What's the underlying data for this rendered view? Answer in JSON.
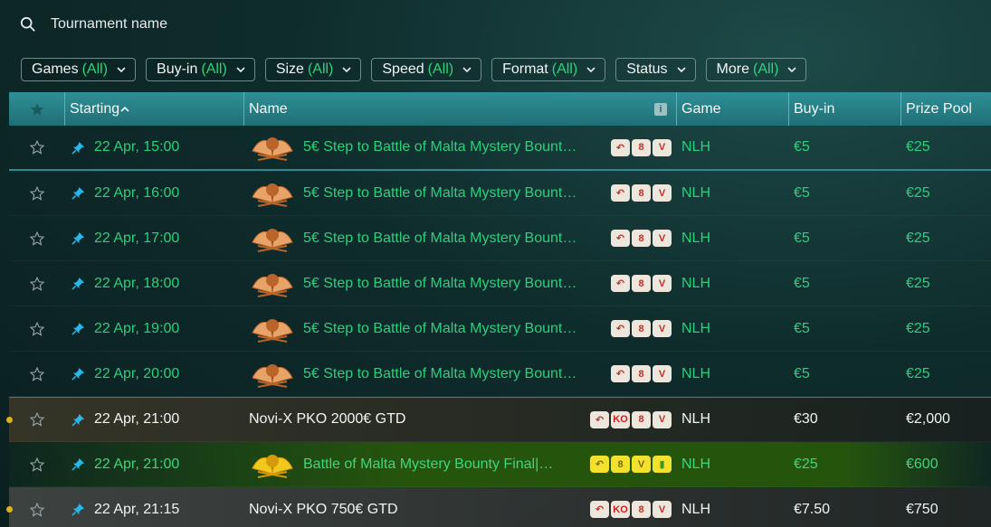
{
  "search": {
    "placeholder": "Tournament name"
  },
  "filters": [
    {
      "label": "Games",
      "value": "(All)"
    },
    {
      "label": "Buy-in",
      "value": "(All)"
    },
    {
      "label": "Size",
      "value": "(All)"
    },
    {
      "label": "Speed",
      "value": "(All)"
    },
    {
      "label": "Format",
      "value": "(All)"
    },
    {
      "label": "Status",
      "value": ""
    },
    {
      "label": "More",
      "value": "(All)"
    }
  ],
  "columns": {
    "starting": "Starting",
    "name": "Name",
    "game": "Game",
    "buyin": "Buy-in",
    "prize": "Prize Pool"
  },
  "rows": [
    {
      "start": "22 Apr, 15:00",
      "name": "5€ Step to Battle of Malta Mystery Bount…",
      "game": "NLH",
      "buyin": "€5",
      "prize": "€25"
    },
    {
      "start": "22 Apr, 16:00",
      "name": "5€ Step to Battle of Malta Mystery Bount…",
      "game": "NLH",
      "buyin": "€5",
      "prize": "€25"
    },
    {
      "start": "22 Apr, 17:00",
      "name": "5€ Step to Battle of Malta Mystery Bount…",
      "game": "NLH",
      "buyin": "€5",
      "prize": "€25"
    },
    {
      "start": "22 Apr, 18:00",
      "name": "5€ Step to Battle of Malta Mystery Bount…",
      "game": "NLH",
      "buyin": "€5",
      "prize": "€25"
    },
    {
      "start": "22 Apr, 19:00",
      "name": "5€ Step to Battle of Malta Mystery Bount…",
      "game": "NLH",
      "buyin": "€5",
      "prize": "€25"
    },
    {
      "start": "22 Apr, 20:00",
      "name": "5€ Step to Battle of Malta Mystery Bount…",
      "game": "NLH",
      "buyin": "€5",
      "prize": "€25"
    },
    {
      "start": "22 Apr, 21:00",
      "name": "Novi-X PKO 2000€ GTD",
      "game": "NLH",
      "buyin": "€30",
      "prize": "€2,000"
    },
    {
      "start": "22 Apr, 21:00",
      "name": "Battle of Malta Mystery Bounty Final|…",
      "game": "NLH",
      "buyin": "€25",
      "prize": "€600"
    },
    {
      "start": "22 Apr, 21:15",
      "name": "Novi-X PKO 750€ GTD",
      "game": "NLH",
      "buyin": "€7.50",
      "prize": "€750"
    }
  ],
  "badges": {
    "ko": "KO",
    "eight": "8",
    "v": "V"
  },
  "colors": {
    "accent_green": "#2ed47a",
    "header_teal": "#2f8f96",
    "gold_border": "#8d6d1d"
  }
}
